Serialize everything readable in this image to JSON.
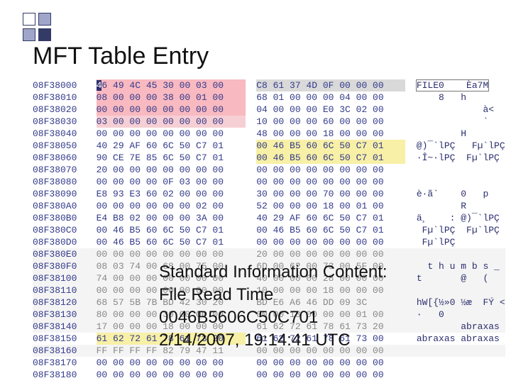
{
  "title": "MFT Table Entry",
  "overlay": {
    "line1": "Standard Information Content:",
    "line2": "File Read Time",
    "line3": "0046B5606C50C701",
    "line4": "2/14/2007, 19:14:41 UTC"
  },
  "hex_rows": [
    {
      "addr": "08F38000",
      "b1": "46 49 4C 45 30 00 03 00",
      "b2": "C8 61 37 4D 0F 00 00 00",
      "ascii": "FILE0    Èa7M",
      "style1": "pink",
      "style2": "grey",
      "asciiStyle": "boxed"
    },
    {
      "addr": "08F38010",
      "b1": "08 00 00 00 38 00 01 00",
      "b2": "68 01 00 00 00 04 00 00",
      "ascii": "    8   h",
      "style1": "pink"
    },
    {
      "addr": "08F38020",
      "b1": "00 00 00 00 00 00 00 00",
      "b2": "04 00 00 00 E0 3C 02 00",
      "ascii": "            à<",
      "style1": "pink"
    },
    {
      "addr": "08F38030",
      "b1": "03 00 00 00 00 00 00 00",
      "b2": "10 00 00 00 60 00 00 00",
      "ascii": "            `",
      "style1": "pink-dim"
    },
    {
      "addr": "08F38040",
      "b1": "00 00 00 00 00 00 00 00",
      "b2": "48 00 00 00 18 00 00 00",
      "ascii": "        H"
    },
    {
      "addr": "08F38050",
      "b1": "40 29 AF 60 6C 50 C7 01",
      "b2": "00 46 B5 60 6C 50 C7 01",
      "ascii": "@)¯`lPÇ   Fµ`lPÇ",
      "style2": "yellow"
    },
    {
      "addr": "08F38060",
      "b1": "90 CE 7E 85 6C 50 C7 01",
      "b2": "00 46 B5 60 6C 50 C7 01",
      "ascii": "∙Î~∙lPÇ  Fµ`lPÇ",
      "style2": "yellow"
    },
    {
      "addr": "08F38070",
      "b1": "20 00 00 00 00 00 00 00",
      "b2": "00 00 00 00 00 00 00 00",
      "ascii": ""
    },
    {
      "addr": "08F38080",
      "b1": "00 00 00 00 0F 03 00 00",
      "b2": "00 00 00 00 00 00 00 00",
      "ascii": ""
    },
    {
      "addr": "08F38090",
      "b1": "E8 93 E3 60 02 00 00 00",
      "b2": "30 00 00 00 70 00 00 00",
      "ascii": "è∙ã`    0   p"
    },
    {
      "addr": "08F380A0",
      "b1": "00 00 00 00 00 00 02 00",
      "b2": "52 00 00 00 18 00 01 00",
      "ascii": "        R"
    },
    {
      "addr": "08F380B0",
      "b1": "E4 B8 02 00 00 00 3A 00",
      "b2": "40 29 AF 60 6C 50 C7 01",
      "ascii": "ä¸    : @)¯`lPÇ"
    },
    {
      "addr": "08F380C0",
      "b1": "00 46 B5 60 6C 50 C7 01",
      "b2": "00 46 B5 60 6C 50 C7 01",
      "ascii": " Fµ`lPÇ  Fµ`lPÇ"
    },
    {
      "addr": "08F380D0",
      "b1": "00 46 B5 60 6C 50 C7 01",
      "b2": "00 00 00 00 00 00 00 00",
      "ascii": " Fµ`lPÇ"
    },
    {
      "addr": "08F380E0",
      "b1": "00 00 00 00 00 00 00 00",
      "b2": "20 00 00 00 00 00 00 00",
      "ascii": "",
      "row": "grey"
    },
    {
      "addr": "08F380F0",
      "b1": "08 03 74 00 68 00 75 00",
      "b2": "6D 00 62 00 73 00 5F 00",
      "ascii": "  t h u m b s _",
      "row": "grey"
    },
    {
      "addr": "08F38100",
      "b1": "74 00 00 00 00 00 00 00",
      "b2": "40 00 00 00 28 00 00 00",
      "ascii": "t       @   (",
      "row": "grey"
    },
    {
      "addr": "08F38110",
      "b1": "00 00 00 00 00 00 00 00",
      "b2": "10 00 00 00 18 00 00 00",
      "ascii": "",
      "row": "grey"
    },
    {
      "addr": "08F38120",
      "b1": "68 57 5B 7B BD 42 30 20",
      "b2": "BD E6 A6 46 DD 09 3C",
      "ascii": "hW[{½»0 ½æ  FÝ <",
      "row": "grey"
    },
    {
      "addr": "08F38130",
      "b1": "80 00 00 00 30 00 00 00",
      "b2": "00 00 18 00 00 00 01 00",
      "ascii": "∙   0",
      "row": "grey"
    },
    {
      "addr": "08F38140",
      "b1": "17 00 00 00 18 00 00 00",
      "b2": "61 62 72 61 78 61 73 20",
      "ascii": "        abraxas",
      "row": "grey"
    },
    {
      "addr": "08F38150",
      "b1": "61 62 72 61 78 61 73 20",
      "b2": "61 62 72 61 78 61 73 00",
      "ascii": "abraxas abraxas",
      "style1": "yellow",
      "style2": "grey-row"
    },
    {
      "addr": "08F38160",
      "b1": "FF FF FF FF 82 79 47 11",
      "b2": "00 00 00 00 00 00 00 00",
      "ascii": "",
      "row": "grey"
    },
    {
      "addr": "08F38170",
      "b1": "00 00 00 00 00 00 00 00",
      "b2": "00 00 00 00 00 00 00 00",
      "ascii": ""
    },
    {
      "addr": "08F38180",
      "b1": "00 00 00 00 00 00 00 00",
      "b2": "00 00 00 00 00 00 00 00",
      "ascii": ""
    }
  ]
}
